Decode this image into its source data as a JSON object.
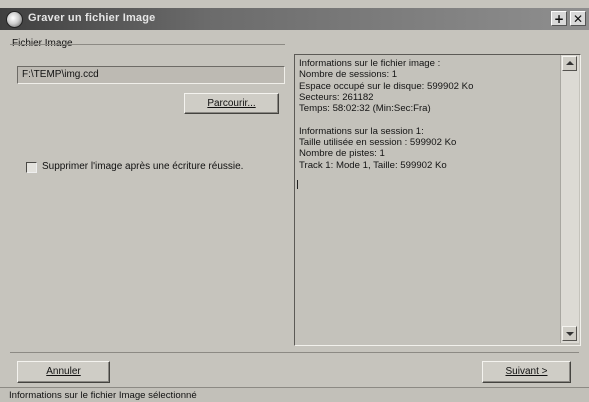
{
  "window": {
    "title": "Graver un fichier Image",
    "help_label": "+",
    "close_label": "✕"
  },
  "group": {
    "label": "Fichier Image"
  },
  "file_input": {
    "value": "F:\\TEMP\\img.ccd"
  },
  "browse_button": {
    "label": "Parcourir..."
  },
  "delete_option": {
    "label": "Supprimer l'image après une écriture réussie.",
    "checked": false
  },
  "info": {
    "lines": [
      "Informations sur le fichier image :",
      "Nombre de sessions: 1",
      "Espace occupé sur le disque: 599902 Ko",
      "Secteurs: 261182",
      "Temps: 58:02:32 (Min:Sec:Fra)",
      "",
      "Informations sur la session 1:",
      "Taille utilisée en session : 599902 Ko",
      "Nombre de pistes: 1",
      "Track 1: Mode 1, Taille: 599902 Ko"
    ]
  },
  "buttons": {
    "cancel": "Annuler",
    "next": "Suivant >"
  },
  "status": {
    "text": "Informations sur le fichier Image sélectionné"
  }
}
